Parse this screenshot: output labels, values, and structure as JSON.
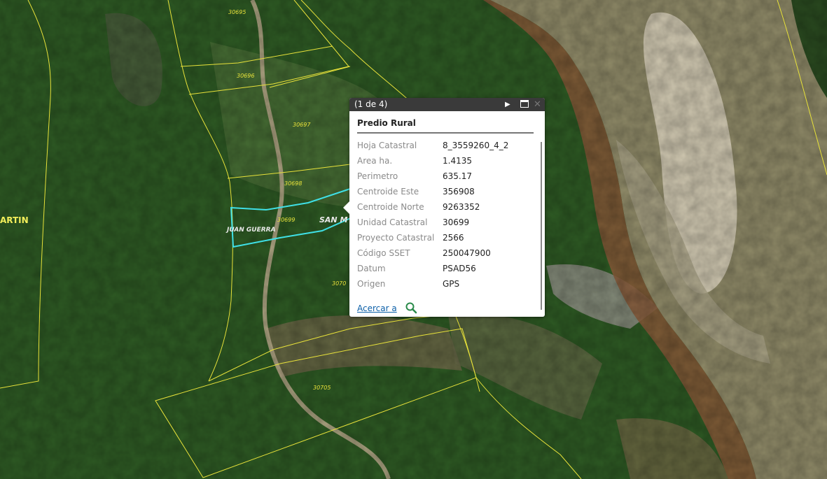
{
  "map": {
    "parcel_labels": [
      "30695",
      "30696",
      "30697",
      "30698",
      "30699",
      "3070",
      "30705"
    ],
    "place_labels": [
      "ARTIN",
      "JUAN GUERRA",
      "SAN M"
    ],
    "colors": {
      "parcel_outline": "#e8e23a",
      "selected_outline": "#3fe0e6",
      "river": "#8f8a68",
      "vegetation": "#2c5a22"
    }
  },
  "popup": {
    "counter": "(1 de 4)",
    "title": "Predio Rural",
    "attributes": [
      {
        "key": "Hoja Catastral",
        "value": "8_3559260_4_2"
      },
      {
        "key": "Area ha.",
        "value": "1.4135"
      },
      {
        "key": "Perimetro",
        "value": "635.17"
      },
      {
        "key": "Centroide Este",
        "value": "356908"
      },
      {
        "key": "Centroide Norte",
        "value": "9263352"
      },
      {
        "key": "Unidad Catastral",
        "value": "30699"
      },
      {
        "key": "Proyecto Catastral",
        "value": "2566"
      },
      {
        "key": "Código SSET",
        "value": "250047900"
      },
      {
        "key": "Datum",
        "value": "PSAD56"
      },
      {
        "key": "Origen",
        "value": "GPS"
      }
    ],
    "zoom_label": "Acercar a",
    "icons": {
      "next": "play-icon",
      "maximize": "maximize-icon",
      "close": "close-icon",
      "zoom": "search-icon"
    }
  }
}
